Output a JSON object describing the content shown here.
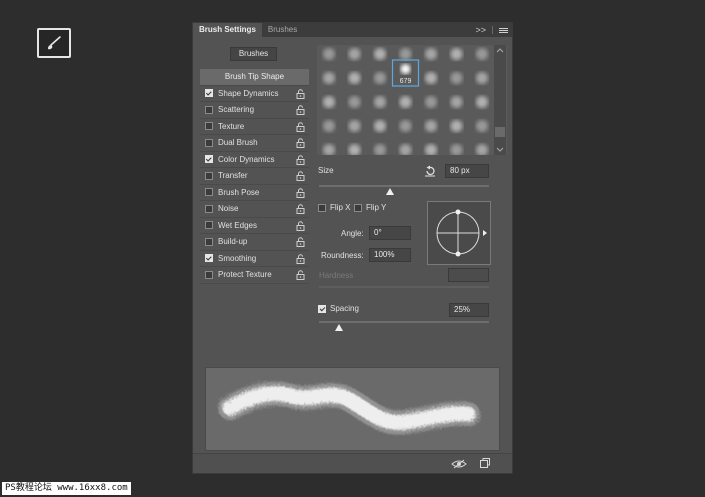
{
  "toolbar": {
    "brush_tool_icon": "brush-icon"
  },
  "panel": {
    "tabs": [
      {
        "label": "Brush Settings",
        "active": true
      },
      {
        "label": "Brushes",
        "active": false
      }
    ],
    "expand_label": ">>",
    "menu_icon": "menu-lines-icon",
    "brushes_button": "Brushes",
    "header_option": "Brush Tip Shape",
    "options": [
      {
        "label": "Shape Dynamics",
        "checked": true
      },
      {
        "label": "Scattering",
        "checked": false
      },
      {
        "label": "Texture",
        "checked": false
      },
      {
        "label": "Dual Brush",
        "checked": false
      },
      {
        "label": "Color Dynamics",
        "checked": true
      },
      {
        "label": "Transfer",
        "checked": false
      },
      {
        "label": "Brush Pose",
        "checked": false
      },
      {
        "label": "Noise",
        "checked": false
      },
      {
        "label": "Wet Edges",
        "checked": false
      },
      {
        "label": "Build-up",
        "checked": false
      },
      {
        "label": "Smoothing",
        "checked": true
      },
      {
        "label": "Protect Texture",
        "checked": false
      }
    ],
    "selected_preset_number": "679",
    "size": {
      "label": "Size",
      "value": "80 px",
      "fraction": 0.42
    },
    "flip_x": {
      "label": "Flip X",
      "checked": false
    },
    "flip_y": {
      "label": "Flip Y",
      "checked": false
    },
    "angle": {
      "label": "Angle:",
      "value": "0°"
    },
    "roundness": {
      "label": "Roundness:",
      "value": "100%"
    },
    "hardness": {
      "label": "Hardness",
      "value": ""
    },
    "spacing": {
      "label": "Spacing",
      "checked": true,
      "value": "25%",
      "fraction": 0.12
    }
  },
  "watermark": "PS教程论坛 www.16xx8.com"
}
